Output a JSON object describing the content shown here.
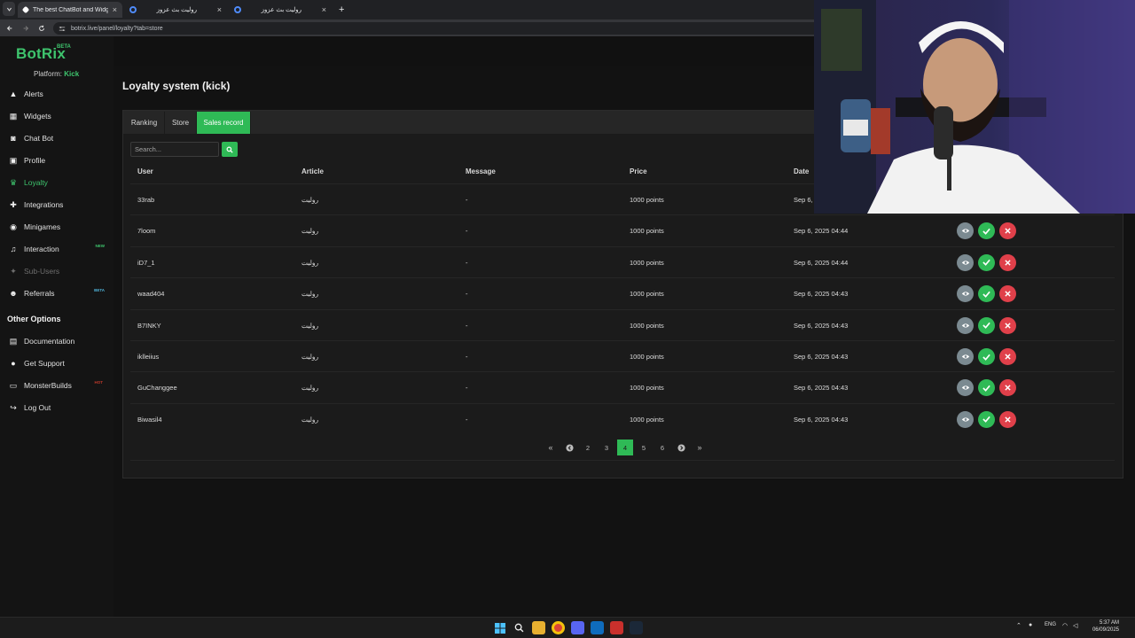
{
  "browser": {
    "tabs": [
      {
        "title": "The best ChatBot and Widgets",
        "icon_color": "#ffffff"
      },
      {
        "title": "روليت بث عزوز",
        "icon_color": "#4f8bf9"
      },
      {
        "title": "روليت بث عزوز",
        "icon_color": "#4f8bf9"
      }
    ],
    "tab_close": "×",
    "new_tab": "+",
    "url": "botrix.live/panel/loyalty?tab=store"
  },
  "sidebar": {
    "logo": "BotRix",
    "logo_badge": "BETA",
    "platform_label": "Platform:",
    "platform_value": "Kick",
    "items": [
      {
        "label": "Alerts",
        "icon": "alert-triangle-icon"
      },
      {
        "label": "Widgets",
        "icon": "grid-icon"
      },
      {
        "label": "Chat Bot",
        "icon": "robot-icon"
      },
      {
        "label": "Profile",
        "icon": "id-card-icon"
      },
      {
        "label": "Loyalty",
        "icon": "trophy-icon",
        "active": true
      },
      {
        "label": "Integrations",
        "icon": "puzzle-icon"
      },
      {
        "label": "Minigames",
        "icon": "gamepad-icon"
      },
      {
        "label": "Interaction",
        "icon": "music-note-icon",
        "badge": "NEW"
      },
      {
        "label": "Sub-Users",
        "icon": "user-plus-icon",
        "muted": true
      },
      {
        "label": "Referrals",
        "icon": "users-icon",
        "badge": "BETA"
      }
    ],
    "other_options_title": "Other Options",
    "other_items": [
      {
        "label": "Documentation",
        "icon": "book-icon"
      },
      {
        "label": "Get Support",
        "icon": "question-circle-icon"
      },
      {
        "label": "MonsterBuilds",
        "icon": "monitor-icon",
        "badge": "HOT"
      },
      {
        "label": "Log Out",
        "icon": "logout-icon"
      }
    ]
  },
  "page": {
    "title": "Loyalty system (kick)",
    "tabs": [
      "Ranking",
      "Store",
      "Sales record"
    ],
    "active_tab": "Sales record",
    "search_placeholder": "Search...",
    "columns": [
      "User",
      "Article",
      "Message",
      "Price",
      "Date"
    ],
    "rows": [
      {
        "user": "33rab",
        "article": "روليت",
        "message": "-",
        "price": "1000 points",
        "date": "Sep 6,"
      },
      {
        "user": "7loom",
        "article": "روليت",
        "message": "-",
        "price": "1000 points",
        "date": "Sep 6, 2025 04:44"
      },
      {
        "user": "iD7_1",
        "article": "روليت",
        "message": "-",
        "price": "1000 points",
        "date": "Sep 6, 2025 04:44"
      },
      {
        "user": "waad404",
        "article": "روليت",
        "message": "-",
        "price": "1000 points",
        "date": "Sep 6, 2025 04:43"
      },
      {
        "user": "B7INKY",
        "article": "روليت",
        "message": "-",
        "price": "1000 points",
        "date": "Sep 6, 2025 04:43"
      },
      {
        "user": "iklleiius",
        "article": "روليت",
        "message": "-",
        "price": "1000 points",
        "date": "Sep 6, 2025 04:43"
      },
      {
        "user": "GuChanggee",
        "article": "روليت",
        "message": "-",
        "price": "1000 points",
        "date": "Sep 6, 2025 04:43"
      },
      {
        "user": "Biwasil4",
        "article": "روليت",
        "message": "-",
        "price": "1000 points",
        "date": "Sep 6, 2025 04:43"
      }
    ],
    "pagination": {
      "first": "«",
      "prev": "‹",
      "pages": [
        "2",
        "3",
        "4",
        "5",
        "6"
      ],
      "current": "4",
      "next": "›",
      "last": "»"
    }
  },
  "taskbar": {
    "lang": "ENG",
    "time": "5:37 AM",
    "date": "06/09/2025"
  },
  "colors": {
    "accent": "#2fba56",
    "danger": "#e0404a",
    "neutral_action": "#7b8a91",
    "background": "#121212"
  }
}
